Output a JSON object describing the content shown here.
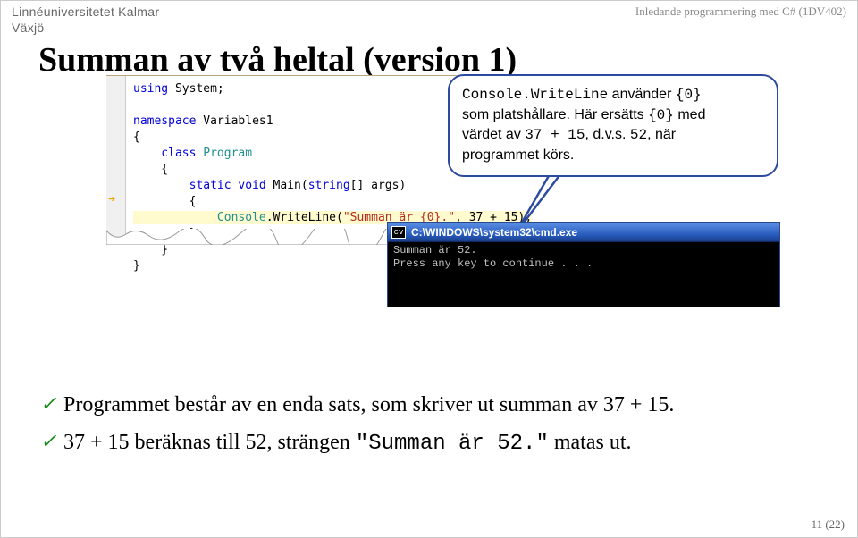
{
  "header": {
    "brand": "Linnéuniversitetet",
    "campus1": "Kalmar",
    "campus2": "Växjö",
    "course": "Inledande programmering med C# (1DV402)"
  },
  "title": "Summan av två heltal (version 1)",
  "code": {
    "line1a": "using",
    "line1b": " System;",
    "line2a": "namespace",
    "line2b": " Variables1",
    "line3": "{",
    "line4a": "    class ",
    "line4b": "Program",
    "line5": "    {",
    "line6a": "        static void ",
    "line6b": "Main(",
    "line6c": "string",
    "line6d": "[] args)",
    "line7": "        {",
    "line8a": "            ",
    "line8b": "Console",
    "line8c": ".WriteLine(",
    "line8d": "\"Summan är {0}.\"",
    "line8e": ", 37 + 15);",
    "line9": "        }",
    "line10": "    }",
    "line11": "}"
  },
  "callout": {
    "c_console": "Console",
    "c_write": ".WriteLine",
    "c_rest1": " använder ",
    "c_ph": "{0}",
    "c_end1": "",
    "c_line2a": "som platshållare. Här ersätts ",
    "c_ph2": "{0}",
    "c_line2b": " med",
    "c_line3a": "värdet av ",
    "c_expr": "37 + 15",
    "c_line3b": ", d.v.s. ",
    "c_val": "52",
    "c_line3c": ", när",
    "c_line4": "programmet körs."
  },
  "cmd": {
    "title": "C:\\WINDOWS\\system32\\cmd.exe",
    "icon": "cv",
    "l1": "Summan är 52.",
    "l2": "Press any key to continue . . ."
  },
  "bullets": {
    "b1": "Programmet består av en enda sats, som skriver ut summan av 37 + 15.",
    "b2a": "37 + 15 beräknas till 52, strängen ",
    "b2code": "\"Summan är 52.\"",
    "b2b": " matas ut."
  },
  "pagenum": "11 (22)"
}
